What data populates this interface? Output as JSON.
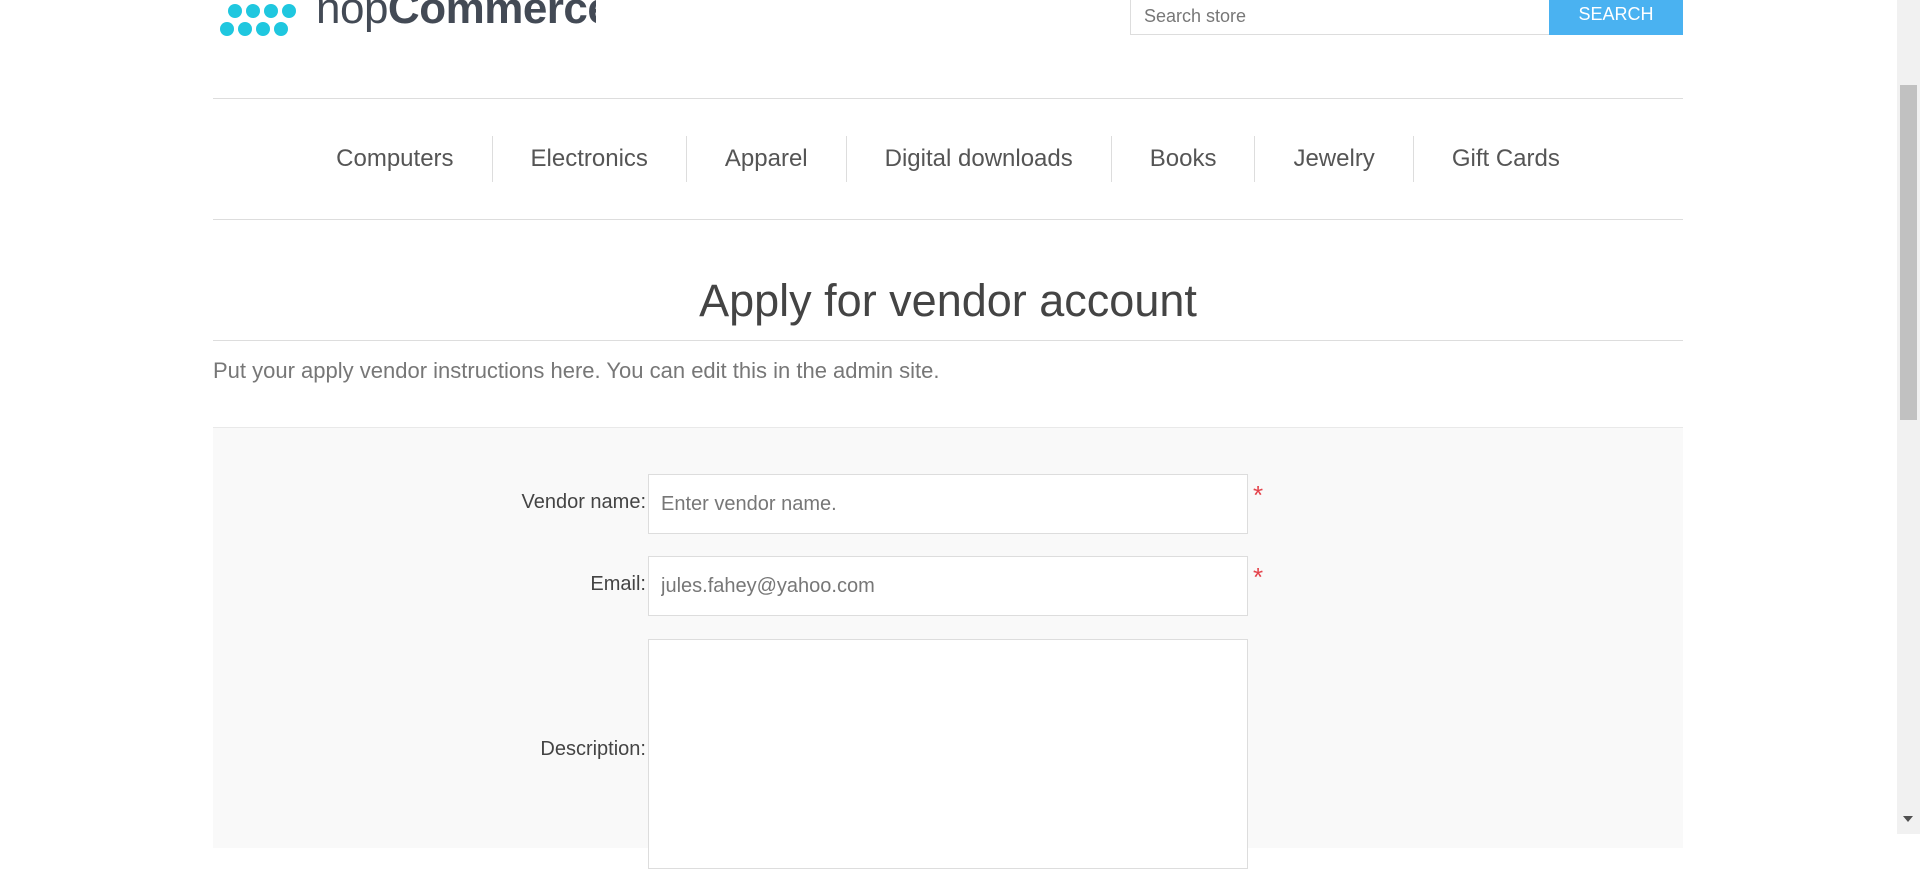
{
  "header": {
    "logo_text_light": "nop",
    "logo_text_bold": "Commerce",
    "search_placeholder": "Search store",
    "search_button_label": "Search"
  },
  "menu": {
    "items": [
      {
        "label": "Computers"
      },
      {
        "label": "Electronics"
      },
      {
        "label": "Apparel"
      },
      {
        "label": "Digital downloads"
      },
      {
        "label": "Books"
      },
      {
        "label": "Jewelry"
      },
      {
        "label": "Gift Cards"
      }
    ]
  },
  "page": {
    "title": "Apply for vendor account",
    "instructions": "Put your apply vendor instructions here. You can edit this in the admin site."
  },
  "form": {
    "vendor_name": {
      "label": "Vendor name:",
      "placeholder": "Enter vendor name.",
      "value": "",
      "required_mark": "*"
    },
    "email": {
      "label": "Email:",
      "value": "jules.fahey@yahoo.com",
      "required_mark": "*"
    },
    "description": {
      "label": "Description:",
      "value": ""
    }
  },
  "colors": {
    "accent": "#4ab2f1",
    "logo_dots": "#1fc7df",
    "required": "#e4434b"
  },
  "icons": {
    "logo": "nopcommerce-dots-logo",
    "scroll_down": "triangle-down"
  }
}
